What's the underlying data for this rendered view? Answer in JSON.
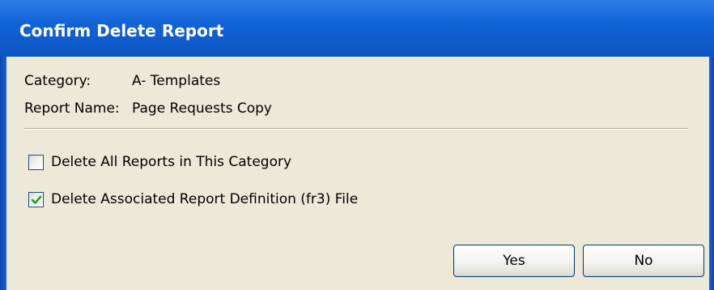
{
  "dialog": {
    "title": "Confirm Delete Report"
  },
  "info": {
    "category_label": "Category:",
    "category_value": "A- Templates",
    "report_name_label": "Report Name:",
    "report_name_value": "Page Requests Copy"
  },
  "options": {
    "delete_all": {
      "label": "Delete All Reports in This Category",
      "checked": false
    },
    "delete_definition": {
      "label": "Delete Associated Report Definition (fr3) File",
      "checked": true
    }
  },
  "buttons": {
    "yes_label": "Yes",
    "no_label": "No"
  },
  "colors": {
    "title_bar": "#0d55c2",
    "client_background": "#ece9d8",
    "check_mark": "#21a121"
  }
}
